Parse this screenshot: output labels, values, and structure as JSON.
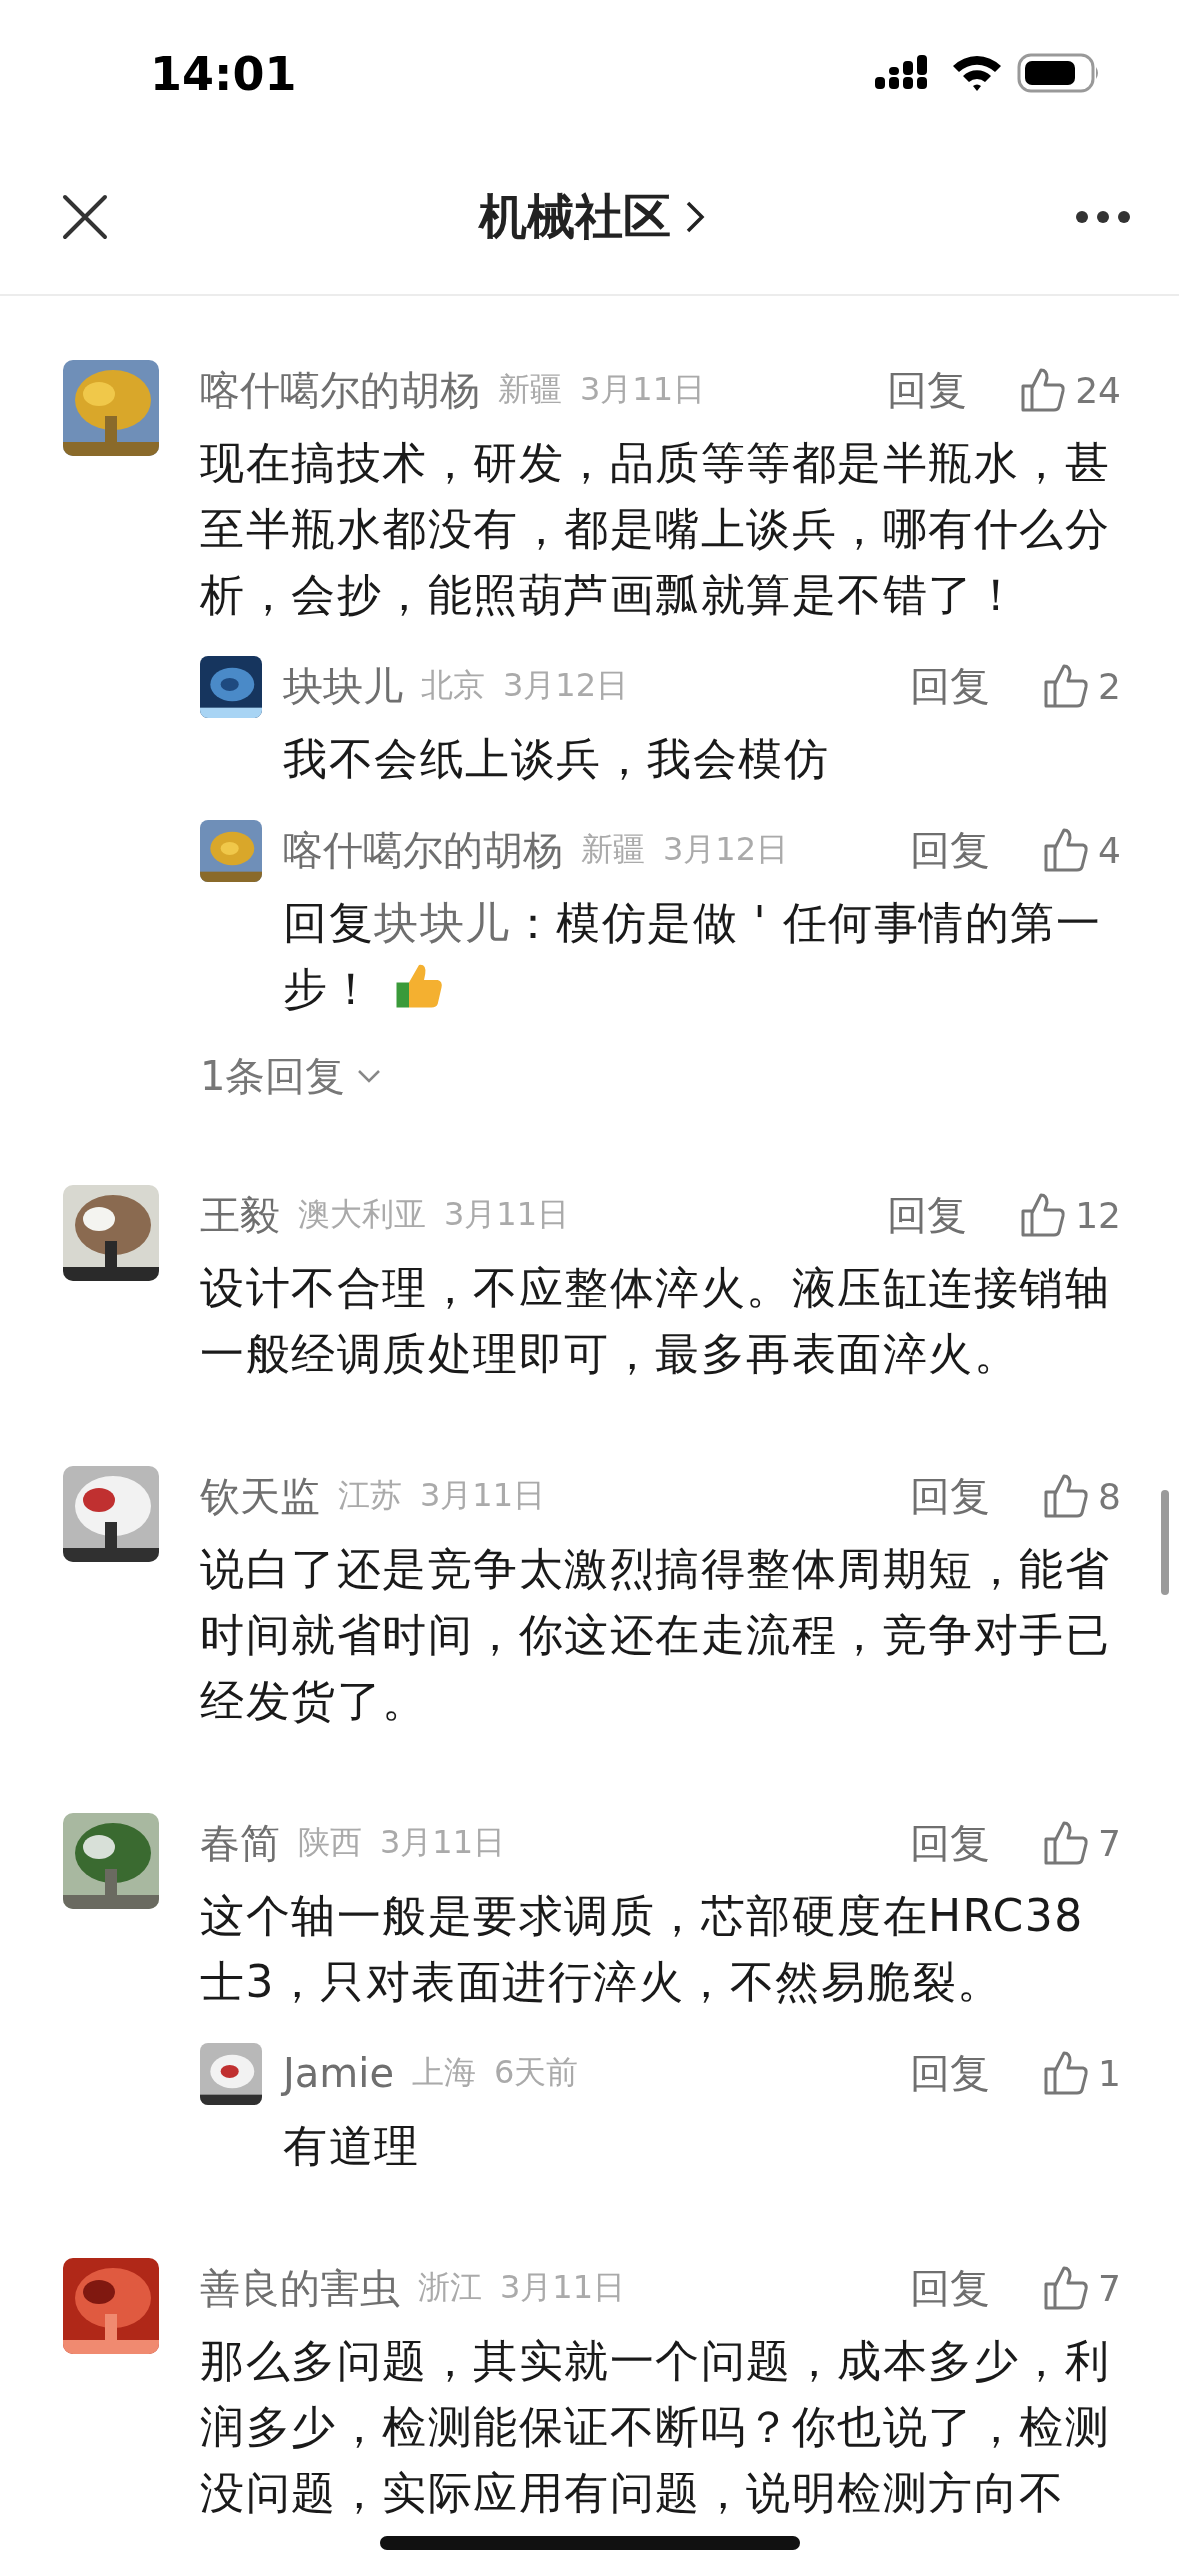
{
  "status_bar": {
    "time": "14:01"
  },
  "nav": {
    "title": "机械社区"
  },
  "comments": [
    {
      "name": "喀什噶尔的胡杨",
      "region": "新疆",
      "date": "3月11日",
      "reply_label": "回复",
      "likes": "24",
      "text": "现在搞技术，研发，品质等等都是半瓶水，甚至半瓶水都没有，都是嘴上谈兵，哪有什么分析，会抄，能照葫芦画瓢就算是不错了！",
      "replies": [
        {
          "name": "块块儿",
          "region": "北京",
          "date": "3月12日",
          "reply_label": "回复",
          "likes": "2",
          "text": "我不会纸上谈兵，我会模仿"
        },
        {
          "name": "喀什噶尔的胡杨",
          "region": "新疆",
          "date": "3月12日",
          "reply_label": "回复",
          "likes": "4",
          "prefix": "回复",
          "reply_to": "块块儿",
          "text": "：模仿是做 ' 任何事情的第一步！",
          "emoji": true
        }
      ],
      "more_replies": "1条回复"
    },
    {
      "name": "王毅",
      "region": "澳大利亚",
      "date": "3月11日",
      "reply_label": "回复",
      "likes": "12",
      "text": "设计不合理，不应整体淬火。液压缸连接销轴一般经调质处理即可，最多再表面淬火。"
    },
    {
      "name": "钦天监",
      "region": "江苏",
      "date": "3月11日",
      "reply_label": "回复",
      "likes": "8",
      "text": "说白了还是竞争太激烈搞得整体周期短，能省时间就省时间，你这还在走流程，竞争对手已经发货了。"
    },
    {
      "name": "春简",
      "region": "陕西",
      "date": "3月11日",
      "reply_label": "回复",
      "likes": "7",
      "text": "这个轴一般是要求调质，芯部硬度在HRC38士3，只对表面进行淬火，不然易脆裂。",
      "replies": [
        {
          "name": "Jamie",
          "region": "上海",
          "date": "6天前",
          "reply_label": "回复",
          "likes": "1",
          "text": "有道理"
        }
      ]
    },
    {
      "name": "善良的害虫",
      "region": "浙江",
      "date": "3月11日",
      "reply_label": "回复",
      "likes": "7",
      "text": "那么多问题，其实就一个问题，成本多少，利润多少，检测能保证不断吗？你也说了，检测没问题，实际应用有问题，说明检测方向不"
    }
  ]
}
